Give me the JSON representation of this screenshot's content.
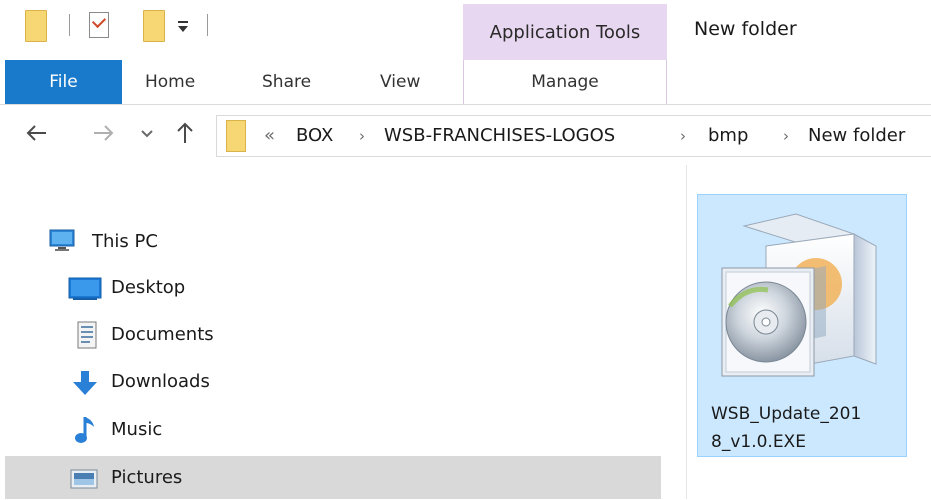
{
  "quick_access": {
    "icons": [
      "folder-icon",
      "properties-icon",
      "new-folder-icon",
      "customize-dropdown-icon"
    ]
  },
  "ribbon": {
    "contextual_group": "Application Tools",
    "window_title": "New folder",
    "tabs": {
      "file": "File",
      "home": "Home",
      "share": "Share",
      "view": "View",
      "manage": "Manage"
    }
  },
  "address": {
    "overflow": "«",
    "separator": "›",
    "crumbs": [
      "BOX",
      "WSB-FRANCHISES-LOGOS",
      "bmp",
      "New folder"
    ]
  },
  "nav_pane": {
    "items": [
      {
        "label": "This PC",
        "icon": "monitor-icon"
      },
      {
        "label": "Desktop",
        "icon": "desktop-icon"
      },
      {
        "label": "Documents",
        "icon": "documents-icon"
      },
      {
        "label": "Downloads",
        "icon": "download-arrow-icon"
      },
      {
        "label": "Music",
        "icon": "music-note-icon"
      },
      {
        "label": "Pictures",
        "icon": "pictures-icon"
      }
    ],
    "selected": "Pictures"
  },
  "files": [
    {
      "name_line1": "WSB_Update_201",
      "name_line2": "8_v1.0.EXE",
      "icon": "installer-box-cd-icon"
    }
  ],
  "colors": {
    "file_tab": "#1979ca",
    "contextual_band": "#e8d7f0",
    "selection_fill": "#cce8ff",
    "selection_border": "#99d1ff",
    "nav_selected": "#d9d9d9",
    "folder": "#f7d774"
  }
}
